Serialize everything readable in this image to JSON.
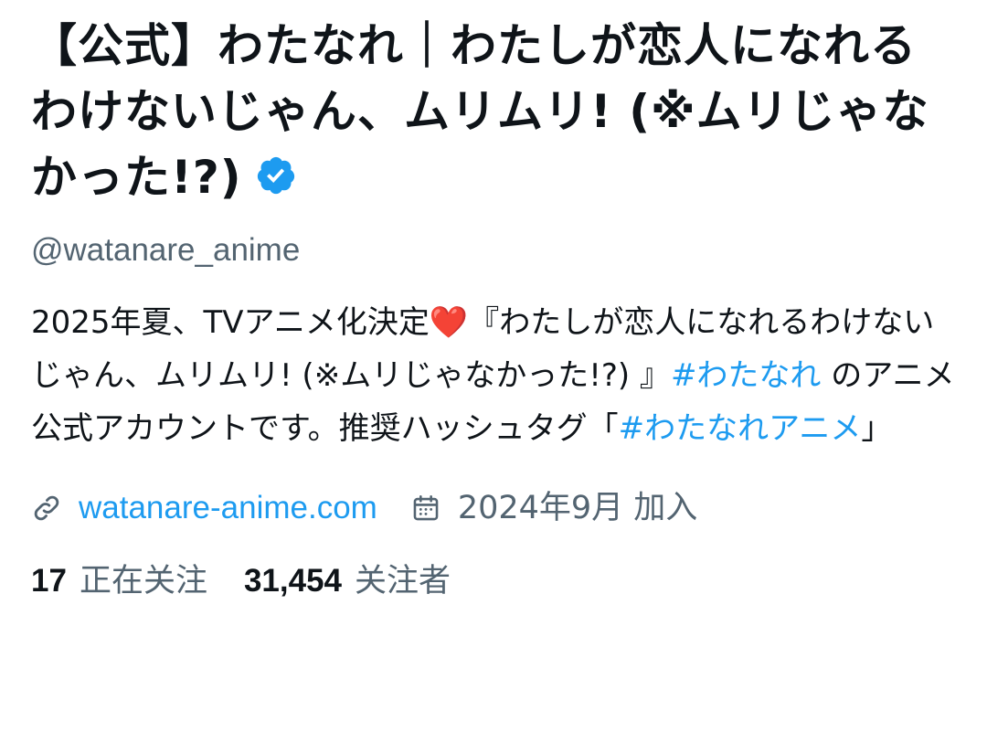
{
  "profile": {
    "display_name": "【公式】わたなれ｜わたしが恋人になれるわけないじゃん、ムリムリ! (※ムリじゃなかった!?)",
    "verified_icon": "verified-badge-icon",
    "handle": "@watanare_anime",
    "bio": {
      "part1": "2025年夏、TVアニメ化決定",
      "heart": "❤️",
      "part2": "『わたしが恋人になれるわけないじゃん、ムリムリ! (※ムリじゃなかった!?) 』",
      "hashtag1": "#わたなれ",
      "part3": " のアニメ公式アカウントです。推奨ハッシュタグ「",
      "hashtag2": "#わたなれアニメ",
      "part4": "」"
    },
    "website": "watanare-anime.com",
    "joined": "2024年9月 加入",
    "following_count": "17",
    "following_label": "正在关注",
    "followers_count": "31,454",
    "followers_label": "关注者"
  },
  "colors": {
    "text": "#0f1419",
    "secondary": "#536471",
    "link": "#1d9bf0",
    "verified": "#1d9bf0",
    "heart": "#e0245e"
  }
}
